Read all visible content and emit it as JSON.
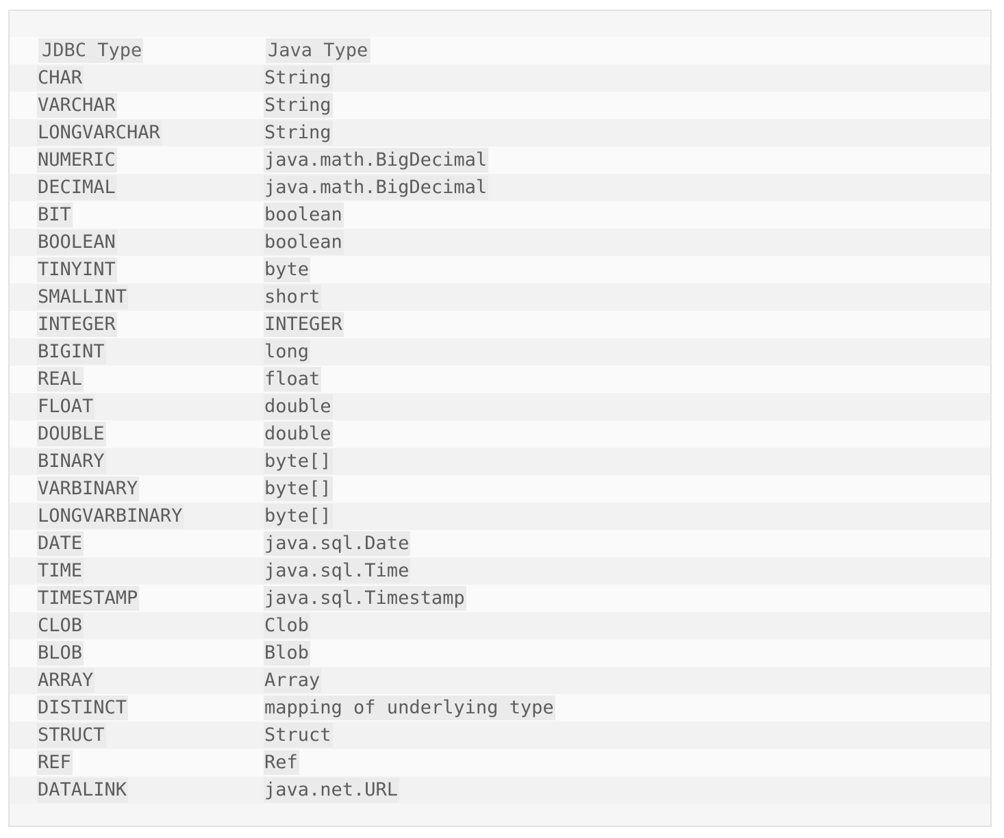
{
  "table": {
    "headers": [
      "JDBC Type",
      "Java Type"
    ],
    "rows": [
      [
        "CHAR",
        "String"
      ],
      [
        "VARCHAR",
        "String"
      ],
      [
        "LONGVARCHAR",
        "String"
      ],
      [
        "NUMERIC",
        "java.math.BigDecimal"
      ],
      [
        "DECIMAL",
        "java.math.BigDecimal"
      ],
      [
        "BIT",
        "boolean"
      ],
      [
        "BOOLEAN",
        "boolean"
      ],
      [
        "TINYINT",
        "byte"
      ],
      [
        "SMALLINT",
        "short"
      ],
      [
        "INTEGER",
        "INTEGER"
      ],
      [
        "BIGINT",
        "long"
      ],
      [
        "REAL",
        "float"
      ],
      [
        "FLOAT",
        "double"
      ],
      [
        "DOUBLE",
        "double"
      ],
      [
        "BINARY",
        "byte[]"
      ],
      [
        "VARBINARY",
        "byte[]"
      ],
      [
        "LONGVARBINARY",
        "byte[]"
      ],
      [
        "DATE",
        "java.sql.Date"
      ],
      [
        "TIME",
        "java.sql.Time"
      ],
      [
        "TIMESTAMP",
        "java.sql.Timestamp"
      ],
      [
        "CLOB",
        "Clob"
      ],
      [
        "BLOB",
        "Blob"
      ],
      [
        "ARRAY",
        "Array"
      ],
      [
        "DISTINCT",
        "mapping of underlying type"
      ],
      [
        "STRUCT",
        "Struct"
      ],
      [
        "REF",
        "Ref"
      ],
      [
        "DATALINK",
        "java.net.URL"
      ]
    ]
  }
}
